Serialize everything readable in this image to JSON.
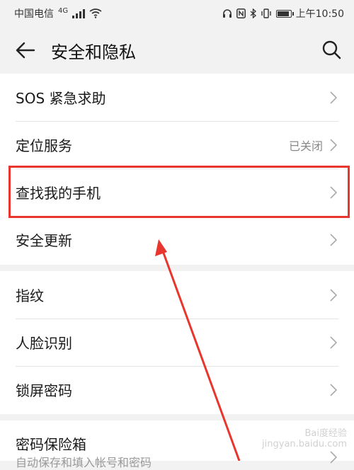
{
  "status_bar": {
    "carrier": "中国电信",
    "network": "4G",
    "time": "上午10:50",
    "battery_level": 0.8
  },
  "header": {
    "title": "安全和隐私",
    "back_icon": "arrow-left-icon",
    "search_icon": "search-icon"
  },
  "section1": [
    {
      "label": "SOS 紧急求助",
      "value": ""
    },
    {
      "label": "定位服务",
      "value": "已关闭"
    },
    {
      "label": "查找我的手机",
      "value": ""
    },
    {
      "label": "安全更新",
      "value": ""
    }
  ],
  "section2": [
    {
      "label": "指纹",
      "value": ""
    },
    {
      "label": "人脸识别",
      "value": ""
    },
    {
      "label": "锁屏密码",
      "value": ""
    }
  ],
  "section3": [
    {
      "label": "密码保险箱",
      "sublabel": "自动保存和填入帐号和密码"
    }
  ],
  "colors": {
    "annotation": "#e8362e",
    "background": "#f2f2f2",
    "card": "#ffffff"
  },
  "watermark": {
    "brand": "Bai度经验",
    "url": "jingyan.baidu.com"
  }
}
